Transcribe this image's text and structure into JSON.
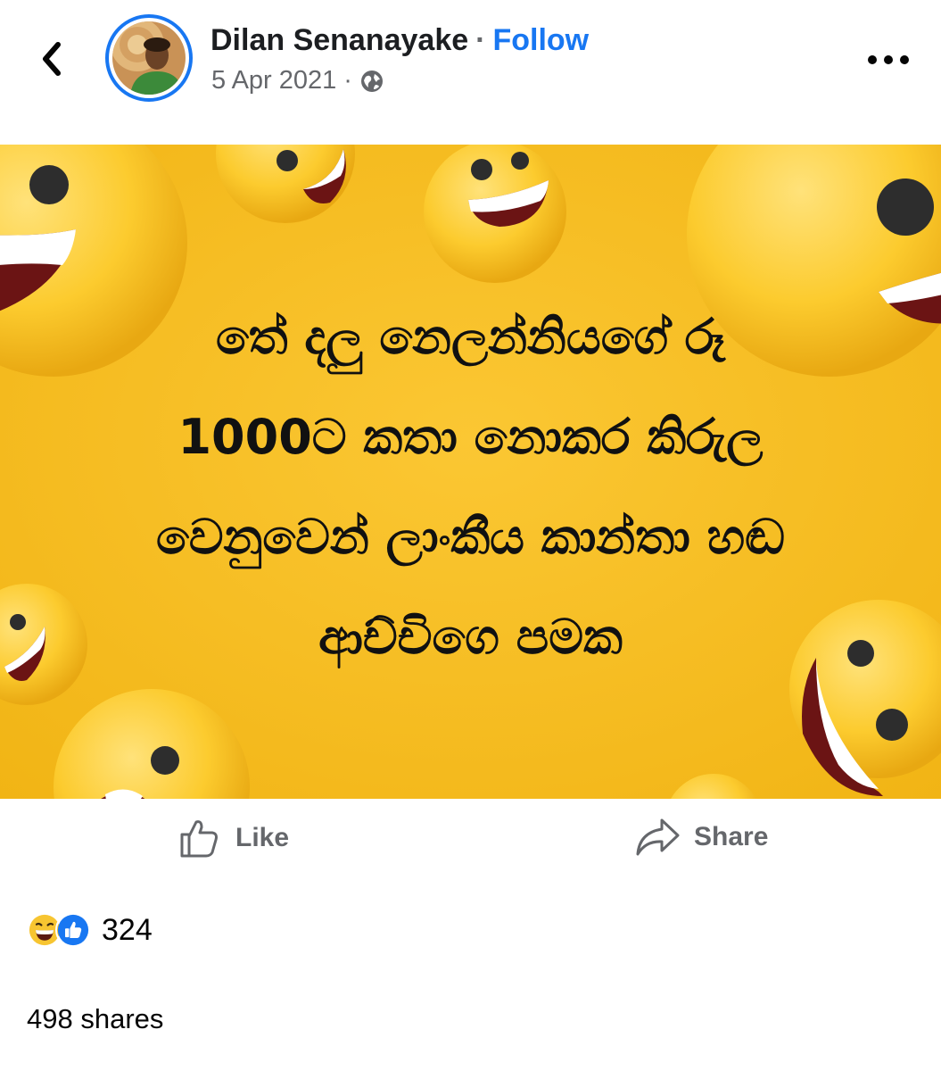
{
  "header": {
    "author_name": "Dilan Senanayake",
    "separator": "·",
    "follow_label": "Follow",
    "date": "5 Apr 2021",
    "meta_separator": "·",
    "privacy_icon": "globe-icon",
    "back_icon": "chevron-left-icon",
    "more_icon": "more-horizontal-icon"
  },
  "post": {
    "text_lines": [
      "තේ දලු නෙලන්නියගේ රූ",
      "1000ට කතා නොකර කිරුල",
      "වෙනුවෙන් ලාංකීය කාන්තා හඬ",
      "ආච්චිගෙ පමක"
    ],
    "background_color": "#f7bd22"
  },
  "actions": {
    "like_label": "Like",
    "share_label": "Share",
    "like_icon": "thumbs-up-icon",
    "share_icon": "share-arrow-icon"
  },
  "stats": {
    "reaction_count": "324",
    "reaction_icons": [
      "haha-reaction-icon",
      "like-reaction-icon"
    ],
    "shares_text": "498 shares"
  },
  "colors": {
    "accent": "#1877f2",
    "secondary_text": "#65676b",
    "image_background": "#f7bd22"
  }
}
